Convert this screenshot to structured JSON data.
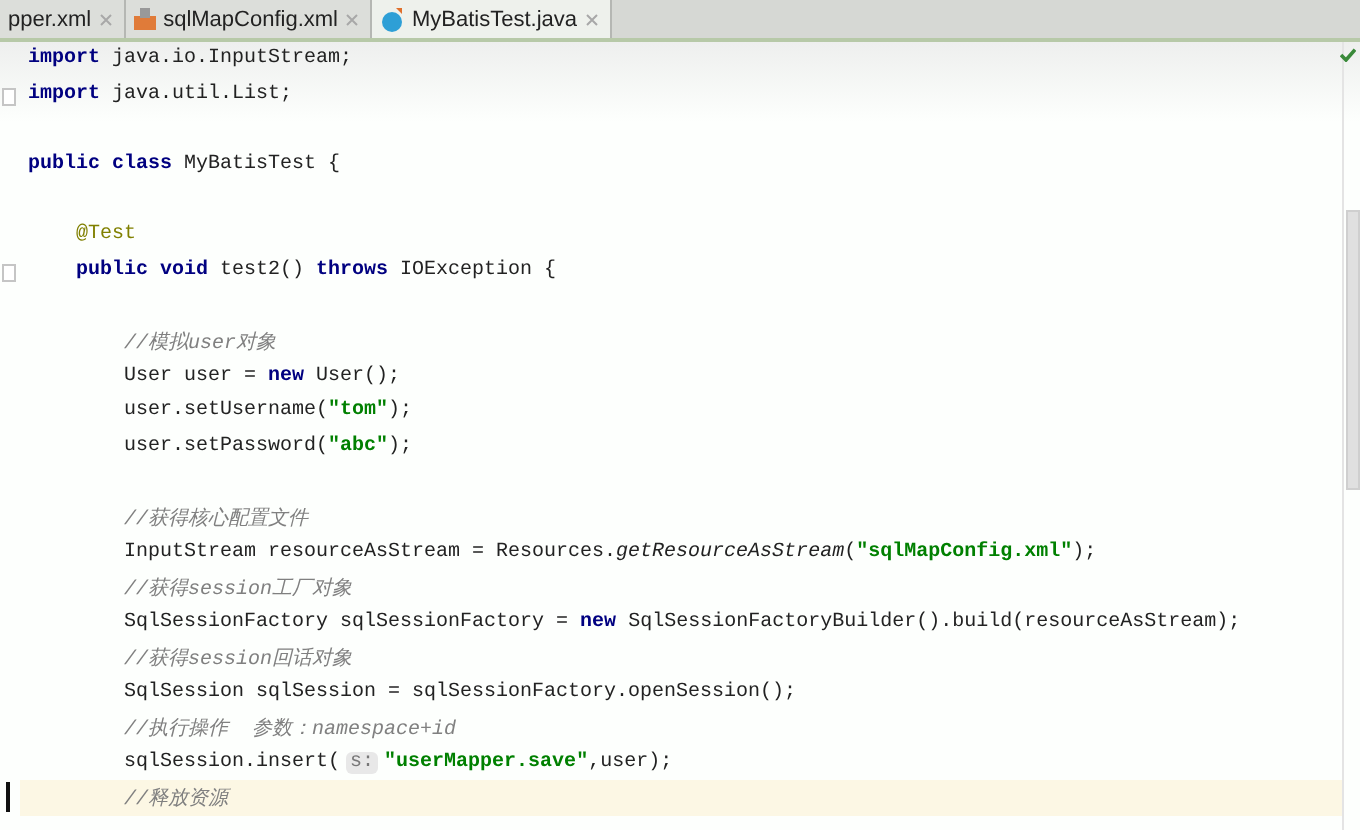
{
  "tabs": [
    {
      "label": "pper.xml",
      "selected": false
    },
    {
      "label": "sqlMapConfig.xml",
      "selected": false
    },
    {
      "label": "MyBatisTest.java",
      "selected": true
    }
  ],
  "editor": {
    "lines": [
      {
        "kind": "top",
        "fold": false,
        "current": false,
        "tokens": [
          {
            "kind": "kw",
            "text": "import"
          },
          {
            "kind": "plain",
            "text": " java.io.InputStream;"
          }
        ]
      },
      {
        "kind": "top",
        "fold": true,
        "current": false,
        "tokens": [
          {
            "kind": "kw",
            "text": "import"
          },
          {
            "kind": "plain",
            "text": " java.util.List;"
          }
        ]
      },
      {
        "kind": "blank",
        "fold": false,
        "current": false
      },
      {
        "kind": "top",
        "fold": false,
        "current": false,
        "tokens": [
          {
            "kind": "kw",
            "text": "public class"
          },
          {
            "kind": "plain",
            "text": " MyBatisTest {"
          }
        ]
      },
      {
        "kind": "blank",
        "fold": false,
        "current": false
      },
      {
        "kind": "member",
        "fold": false,
        "current": false,
        "tokens": [
          {
            "kind": "anno",
            "text": "@Test"
          }
        ]
      },
      {
        "kind": "member",
        "fold": true,
        "current": false,
        "tokens": [
          {
            "kind": "kw",
            "text": "public void"
          },
          {
            "kind": "plain",
            "text": " test2() "
          },
          {
            "kind": "kw",
            "text": "throws"
          },
          {
            "kind": "plain",
            "text": " IOException {"
          }
        ]
      },
      {
        "kind": "blank",
        "fold": false,
        "current": false
      },
      {
        "kind": "body",
        "fold": false,
        "current": false,
        "tokens": [
          {
            "kind": "comment",
            "text": "//模拟user对象"
          }
        ]
      },
      {
        "kind": "body",
        "fold": false,
        "current": false,
        "tokens": [
          {
            "kind": "plain",
            "text": "User user = "
          },
          {
            "kind": "kw",
            "text": "new"
          },
          {
            "kind": "plain",
            "text": " User();"
          }
        ]
      },
      {
        "kind": "body",
        "fold": false,
        "current": false,
        "tokens": [
          {
            "kind": "plain",
            "text": "user.setUsername("
          },
          {
            "kind": "str",
            "text": "\"tom\""
          },
          {
            "kind": "plain",
            "text": ");"
          }
        ]
      },
      {
        "kind": "body",
        "fold": false,
        "current": false,
        "tokens": [
          {
            "kind": "plain",
            "text": "user.setPassword("
          },
          {
            "kind": "str",
            "text": "\"abc\""
          },
          {
            "kind": "plain",
            "text": ");"
          }
        ]
      },
      {
        "kind": "blank",
        "fold": false,
        "current": false
      },
      {
        "kind": "body",
        "fold": false,
        "current": false,
        "tokens": [
          {
            "kind": "comment",
            "text": "//获得核心配置文件"
          }
        ]
      },
      {
        "kind": "body",
        "fold": false,
        "current": false,
        "tokens": [
          {
            "kind": "plain",
            "text": "InputStream resourceAsStream = Resources."
          },
          {
            "kind": "static",
            "text": "getResourceAsStream"
          },
          {
            "kind": "plain",
            "text": "("
          },
          {
            "kind": "str",
            "text": "\"sqlMapConfig.xml\""
          },
          {
            "kind": "plain",
            "text": ");"
          }
        ]
      },
      {
        "kind": "body",
        "fold": false,
        "current": false,
        "tokens": [
          {
            "kind": "comment",
            "text": "//获得session工厂对象"
          }
        ]
      },
      {
        "kind": "body",
        "fold": false,
        "current": false,
        "tokens": [
          {
            "kind": "plain",
            "text": "SqlSessionFactory sqlSessionFactory = "
          },
          {
            "kind": "kw",
            "text": "new"
          },
          {
            "kind": "plain",
            "text": " SqlSessionFactoryBuilder().build(resourceAsStream);"
          }
        ]
      },
      {
        "kind": "body",
        "fold": false,
        "current": false,
        "tokens": [
          {
            "kind": "comment",
            "text": "//获得session回话对象"
          }
        ]
      },
      {
        "kind": "body",
        "fold": false,
        "current": false,
        "tokens": [
          {
            "kind": "plain",
            "text": "SqlSession sqlSession = sqlSessionFactory.openSession();"
          }
        ]
      },
      {
        "kind": "body",
        "fold": false,
        "current": false,
        "tokens": [
          {
            "kind": "comment",
            "text": "//执行操作  参数：namespace+id"
          }
        ]
      },
      {
        "kind": "body",
        "fold": false,
        "current": false,
        "tokens": [
          {
            "kind": "plain",
            "text": "sqlSession.insert("
          },
          {
            "kind": "hint",
            "text": "s:"
          },
          {
            "kind": "str",
            "text": "\"userMapper.save\""
          },
          {
            "kind": "plain",
            "text": ",user);"
          }
        ]
      },
      {
        "kind": "body",
        "fold": false,
        "current": true,
        "tokens": [
          {
            "kind": "comment",
            "text": "//释放资源"
          }
        ]
      }
    ]
  }
}
